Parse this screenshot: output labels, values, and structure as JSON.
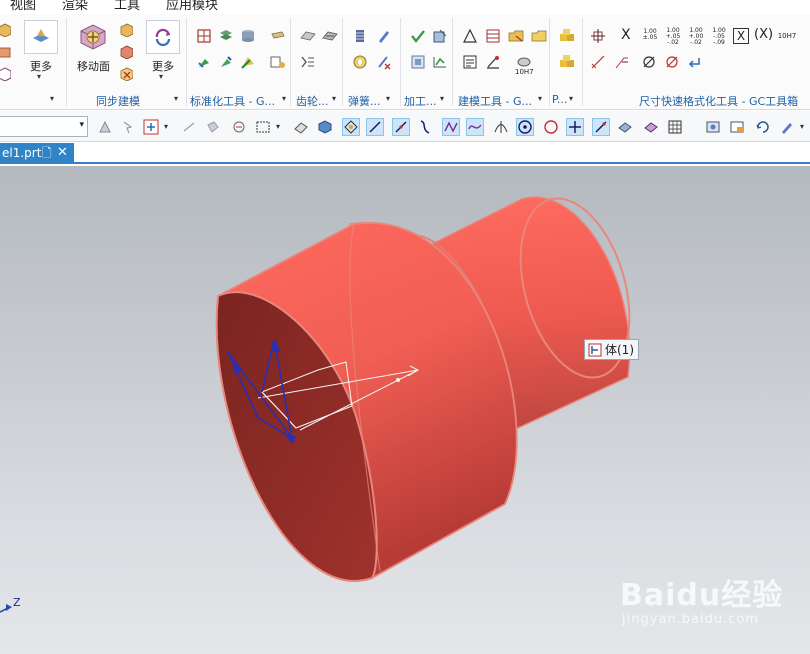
{
  "menu": [
    "视图",
    "渲染",
    "工具",
    "应用模块"
  ],
  "ribbon": {
    "buttons": {
      "more_1": "更多",
      "move_face": "移动面",
      "more_2": "更多"
    },
    "groups": {
      "sync_modeling": "同步建模",
      "standard_tools": "标准化工具 - G...",
      "gear": "齿轮...",
      "spring": "弹簧...",
      "machining": "加工...",
      "modeling_tools": "建模工具 - G...",
      "p_group": "P...",
      "dimension_tools": "尺寸快速格式化工具 - GC工具箱"
    },
    "dim_labels": {
      "x_label": "X",
      "x_paren": "(X)",
      "fit_10h7": "10H7",
      "fit_10h7_small": "10H7",
      "tol_1": [
        "1.00",
        "±.05"
      ],
      "tol_2": [
        "1.00",
        "+.05",
        "-.02"
      ],
      "tol_3": [
        "1.00",
        "+.00",
        "-.02"
      ],
      "tol_4": [
        "1.00",
        "-.05",
        "-.09"
      ]
    }
  },
  "tabs": [
    {
      "label": "el1.prt",
      "dirty_icon": "document-modified-icon",
      "close_glyph": "✕"
    }
  ],
  "viewport": {
    "tooltip": {
      "text": "体(1)",
      "icon": "body-select-icon"
    },
    "axis": {
      "label": "Z"
    },
    "watermark": {
      "brand": "Baidu经验",
      "site": "jingyan.baidu.com"
    }
  },
  "colors": {
    "model_fill": "#f0645a",
    "model_edge": "#e8877e",
    "accent_blue": "#2f83c6",
    "group_label": "#1f5fa8",
    "vector_blue": "#2a2fb0"
  }
}
